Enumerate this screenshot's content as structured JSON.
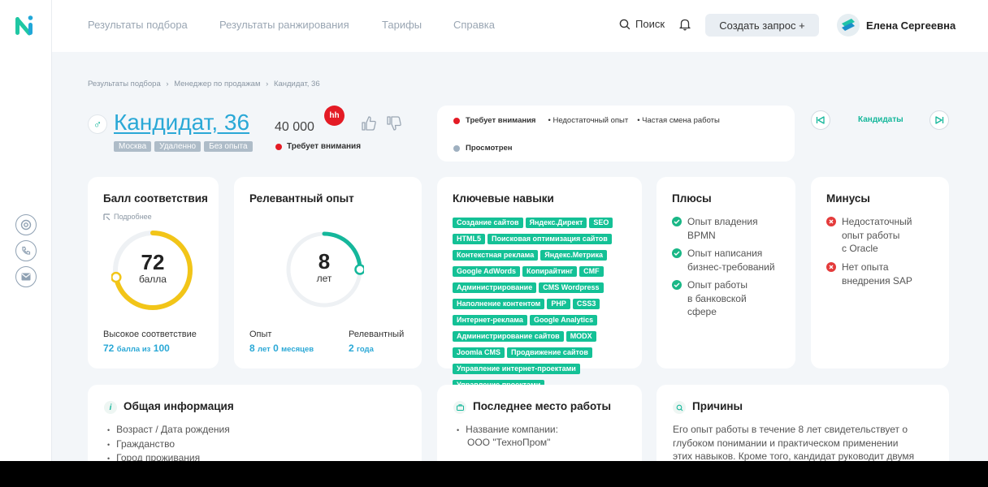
{
  "nav": {
    "items": [
      "Результаты подбора",
      "Результаты ранжирования",
      "Тарифы",
      "Справка"
    ],
    "search_label": "Поиск",
    "create_label": "Создать запрос +",
    "user_name": "Елена Сергеевна"
  },
  "breadcrumb": {
    "items": [
      "Результаты подбора",
      "Менеджер по продажам",
      "Кандидат, 36"
    ],
    "sep": "›"
  },
  "candidate": {
    "name": "Кандидат, 36",
    "salary": "40 000",
    "source_badge": "hh",
    "tags": [
      "Москва",
      "Удаленно",
      "Без опыта"
    ],
    "status": "Требует внимания"
  },
  "status_panel": {
    "attention": "Требует внимания",
    "reasons": [
      "Недостаточный опыт",
      "Частая смена работы"
    ],
    "viewed": "Просмотрен",
    "candidates_link": "Кандидаты"
  },
  "score": {
    "title": "Балл соответствия",
    "more": "Подробнее",
    "value": "72",
    "unit": "балла",
    "fraction": 0.72,
    "level": "Высокое соответствие",
    "summary_value": "72",
    "summary_mid": "балла из",
    "summary_max": "100"
  },
  "experience": {
    "title": "Релевантный опыт",
    "value": "8",
    "unit": "лет",
    "fraction": 0.25,
    "exp_label": "Опыт",
    "exp_years": "8",
    "exp_years_unit": "лет",
    "exp_months": "0",
    "exp_months_unit": "месяцев",
    "rel_label": "Релевантный",
    "rel_years": "2",
    "rel_years_unit": "года"
  },
  "skills": {
    "title": "Ключевые навыки",
    "items": [
      "Создание сайтов",
      "Яндекс.Директ",
      "SEO",
      "HTML5",
      "Поисковая оптимизация сайтов",
      "Контекстная реклама",
      "Яндекс.Метрика",
      "Google AdWords",
      "Копирайтинг",
      "CMF",
      "Администрирование",
      "CMS Wordpress",
      "Наполнение контентом",
      "PHP",
      "CSS3",
      "Интернет-реклама",
      "Google Analytics",
      "Администрирование сайтов",
      "MODX",
      "Joomla CMS",
      "Продвижение сайтов",
      "Управление интернет-проектами",
      "Управление проектами"
    ]
  },
  "pros": {
    "title": "Плюсы",
    "items": [
      [
        "Опыт владения",
        "BPMN"
      ],
      [
        "Опыт написания",
        "бизнес-требований"
      ],
      [
        "Опыт работы",
        "в банковской",
        "сфере"
      ]
    ]
  },
  "cons": {
    "title": "Минусы",
    "items": [
      [
        "Недостаточный",
        "опыт работы",
        "с Oracle"
      ],
      [
        "Нет опыта",
        "внедрения SAP"
      ]
    ]
  },
  "general": {
    "title": "Общая информация",
    "items": [
      "Возраст / Дата рождения",
      "Гражданство",
      "Город проживания"
    ]
  },
  "last_job": {
    "title": "Последнее место работы",
    "company_label": "Название компании:",
    "company_name": "ООО \"ТехноПром\""
  },
  "reasons": {
    "title": "Причины",
    "lines": [
      "Его опыт работы в течение 8 лет свидетельствует о",
      "глубоком понимании и практическом применении",
      "этих навыков. Кроме того, кандидат руководит двумя"
    ]
  },
  "colors": {
    "accent": "#15b79b",
    "link": "#2aa8d6",
    "score_ring": "#f2c518",
    "danger": "#e41b25"
  }
}
